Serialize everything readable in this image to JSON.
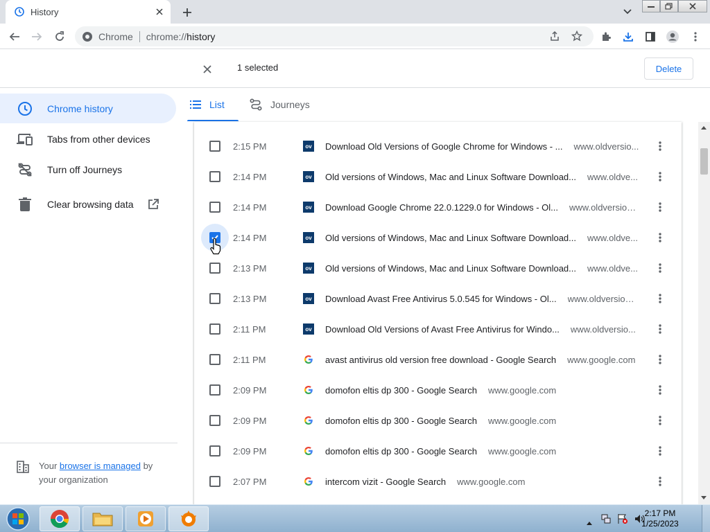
{
  "tab": {
    "title": "History",
    "favicon": "history-icon"
  },
  "toolbar": {
    "site_name": "Chrome",
    "url_scheme": "chrome://",
    "url_host": "history"
  },
  "selection": {
    "count_text": "1 selected",
    "delete_label": "Delete"
  },
  "sidebar": {
    "items": [
      {
        "label": "Chrome history",
        "icon": "clock-icon",
        "active": true
      },
      {
        "label": "Tabs from other devices",
        "icon": "devices-icon"
      },
      {
        "label": "Turn off Journeys",
        "icon": "journeys-off-icon"
      },
      {
        "label": "Clear browsing data",
        "icon": "trash-icon"
      }
    ],
    "managed": {
      "prefix": "Your ",
      "link": "browser is managed",
      "suffix": " by your organization"
    }
  },
  "page_tabs": [
    {
      "label": "List",
      "icon": "list-icon",
      "active": true
    },
    {
      "label": "Journeys",
      "icon": "journeys-icon"
    }
  ],
  "history": [
    {
      "time": "2:15 PM",
      "favicon": "ov",
      "title": "Download Old Versions of Google Chrome for Windows - ...",
      "domain": "www.oldversio...",
      "checked": false
    },
    {
      "time": "2:14 PM",
      "favicon": "ov",
      "title": "Old versions of Windows, Mac and Linux Software Download...",
      "domain": "www.oldve...",
      "checked": false
    },
    {
      "time": "2:14 PM",
      "favicon": "ov",
      "title": "Download Google Chrome 22.0.1229.0 for Windows - Ol...",
      "domain": "www.oldversion...",
      "checked": false
    },
    {
      "time": "2:14 PM",
      "favicon": "ov",
      "title": "Old versions of Windows, Mac and Linux Software Download...",
      "domain": "www.oldve...",
      "checked": true
    },
    {
      "time": "2:13 PM",
      "favicon": "ov",
      "title": "Old versions of Windows, Mac and Linux Software Download...",
      "domain": "www.oldve...",
      "checked": false
    },
    {
      "time": "2:13 PM",
      "favicon": "ov",
      "title": "Download Avast Free Antivirus 5.0.545 for Windows - Ol...",
      "domain": "www.oldversion...",
      "checked": false
    },
    {
      "time": "2:11 PM",
      "favicon": "ov",
      "title": "Download Old Versions of Avast Free Antivirus for Windo...",
      "domain": "www.oldversio...",
      "checked": false
    },
    {
      "time": "2:11 PM",
      "favicon": "google",
      "title": "avast antivirus old version free download - Google Search",
      "domain": "www.google.com",
      "checked": false
    },
    {
      "time": "2:09 PM",
      "favicon": "google",
      "title": "domofon eltis dp 300 - Google Search",
      "domain": "www.google.com",
      "checked": false
    },
    {
      "time": "2:09 PM",
      "favicon": "google",
      "title": "domofon eltis dp 300 - Google Search",
      "domain": "www.google.com",
      "checked": false
    },
    {
      "time": "2:09 PM",
      "favicon": "google",
      "title": "domofon eltis dp 300 - Google Search",
      "domain": "www.google.com",
      "checked": false
    },
    {
      "time": "2:07 PM",
      "favicon": "google",
      "title": "intercom vizit - Google Search",
      "domain": "www.google.com",
      "checked": false
    }
  ],
  "favicon_ov_text": "ov",
  "favicon_google_text": "G",
  "taskbar": {
    "clock_time": "2:17 PM",
    "clock_date": "1/25/2023",
    "apps": [
      "chrome-icon",
      "explorer-icon",
      "media-player-icon",
      "avast-icon"
    ]
  },
  "colors": {
    "accent": "#1a73e8",
    "ov_favicon": "#0d3a6b"
  }
}
